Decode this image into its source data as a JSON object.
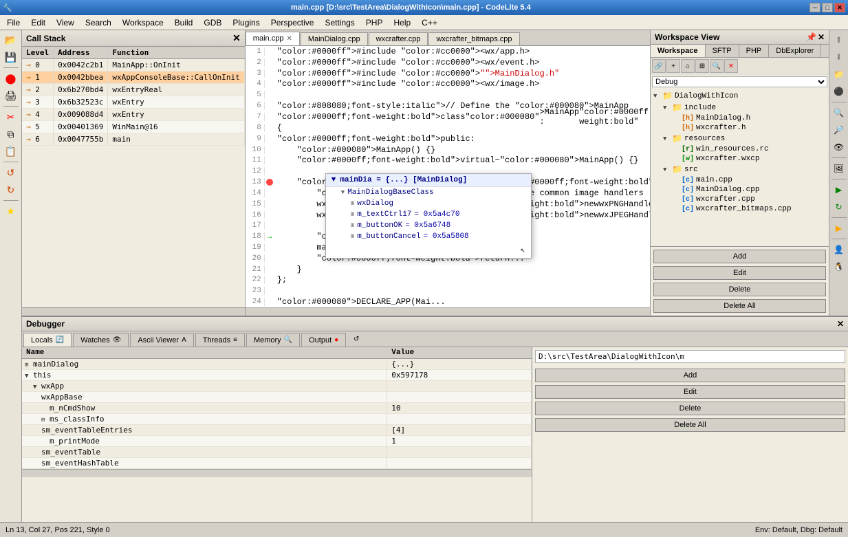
{
  "titlebar": {
    "title": "main.cpp [D:\\src\\TestArea\\DialogWithIcon\\main.cpp] - CodeLite 5.4",
    "min": "─",
    "max": "□",
    "close": "✕"
  },
  "menubar": {
    "items": [
      "File",
      "Edit",
      "View",
      "Search",
      "Workspace",
      "Build",
      "GDB",
      "Plugins",
      "Perspective",
      "Settings",
      "PHP",
      "Help",
      "C++"
    ]
  },
  "callstack": {
    "title": "Call Stack",
    "columns": [
      "Level",
      "Address",
      "Function"
    ],
    "rows": [
      {
        "level": "0",
        "addr": "0x0042c2b1",
        "func": "MainApp::OnInit",
        "active": false,
        "arrow": "→"
      },
      {
        "level": "1",
        "addr": "0x0042bbea",
        "func": "wxAppConsoleBase::CallOnInit",
        "active": true,
        "arrow": "→"
      },
      {
        "level": "2",
        "addr": "0x6b270bd4",
        "func": "wxEntryReal",
        "active": false,
        "arrow": "→"
      },
      {
        "level": "3",
        "addr": "0x6b32523c",
        "func": "wxEntry",
        "active": false,
        "arrow": "→"
      },
      {
        "level": "4",
        "addr": "0x009088d4",
        "func": "wxEntry",
        "active": false,
        "arrow": "→"
      },
      {
        "level": "5",
        "addr": "0x00401369",
        "func": "WinMain@16",
        "active": false,
        "arrow": "→"
      },
      {
        "level": "6",
        "addr": "0x0047755b",
        "func": "main",
        "active": false,
        "arrow": "→"
      }
    ]
  },
  "editor": {
    "tabs": [
      {
        "label": "main.cpp",
        "active": true,
        "modified": false
      },
      {
        "label": "MainDialog.cpp",
        "active": false
      },
      {
        "label": "wxcrafter.cpp",
        "active": false
      },
      {
        "label": "wxcrafter_bitmaps.cpp",
        "active": false
      }
    ],
    "statusline": "Ln 13,  Col 27,  Pos 221,  Style 0"
  },
  "autocomplete": {
    "header": "mainDia = {...} [MainDialog]",
    "items": [
      {
        "indent": 1,
        "expand": "▼",
        "name": "MainDialogBaseClass",
        "val": ""
      },
      {
        "indent": 2,
        "expand": "⊞",
        "name": "wxDialog",
        "val": ""
      },
      {
        "indent": 2,
        "expand": "⊞",
        "name": "m_textCtrl17",
        "val": "= 0x5a4c70"
      },
      {
        "indent": 2,
        "expand": "⊞",
        "name": "m_buttonOK",
        "val": "= 0x5a6748"
      },
      {
        "indent": 2,
        "expand": "⊞",
        "name": "m_buttonCancel",
        "val": "= 0x5a5808"
      }
    ]
  },
  "workspace": {
    "title": "Workspace View",
    "tabs": [
      "Workspace",
      "SFTP",
      "PHP",
      "DbExplorer"
    ],
    "active_tab": "Workspace",
    "debug_config": "Debug",
    "tree": {
      "root": "DialogWithIcon",
      "items": [
        {
          "indent": 0,
          "expand": "▼",
          "icon": "folder",
          "name": "DialogWithIcon"
        },
        {
          "indent": 1,
          "expand": "▼",
          "icon": "folder",
          "name": "include"
        },
        {
          "indent": 2,
          "expand": "",
          "icon": "h",
          "name": "MainDialog.h"
        },
        {
          "indent": 2,
          "expand": "",
          "icon": "h",
          "name": "wxcrafter.h"
        },
        {
          "indent": 1,
          "expand": "▼",
          "icon": "folder",
          "name": "resources"
        },
        {
          "indent": 2,
          "expand": "",
          "icon": "rc",
          "name": "win_resources.rc"
        },
        {
          "indent": 2,
          "expand": "",
          "icon": "wxcp",
          "name": "wxcrafter.wxcp"
        },
        {
          "indent": 1,
          "expand": "▼",
          "icon": "folder",
          "name": "src"
        },
        {
          "indent": 2,
          "expand": "",
          "icon": "cpp",
          "name": "main.cpp"
        },
        {
          "indent": 2,
          "expand": "",
          "icon": "cpp",
          "name": "MainDialog.cpp"
        },
        {
          "indent": 2,
          "expand": "",
          "icon": "cpp",
          "name": "wxcrafter.cpp"
        },
        {
          "indent": 2,
          "expand": "",
          "icon": "cpp",
          "name": "wxcrafter_bitmaps.cpp"
        }
      ]
    },
    "buttons": [
      "Add",
      "Edit",
      "Delete",
      "Delete All"
    ]
  },
  "debugger": {
    "title": "Debugger",
    "tabs": [
      "Locals",
      "Watches",
      "Ascii Viewer",
      "Threads",
      "Memory",
      "Output"
    ],
    "columns": [
      "Name",
      "Value"
    ],
    "locals": [
      {
        "indent": 0,
        "expand": "⊞",
        "name": "mainDialog",
        "val": "{...}"
      },
      {
        "indent": 0,
        "expand": "▼",
        "name": "this",
        "val": "0x597178"
      },
      {
        "indent": 1,
        "expand": "▼",
        "name": "wxApp",
        "val": ""
      },
      {
        "indent": 2,
        "expand": "",
        "name": "wxAppBase",
        "val": ""
      },
      {
        "indent": 3,
        "expand": "",
        "name": "m_nCmdShow",
        "val": "10"
      },
      {
        "indent": 2,
        "expand": "⊞",
        "name": "ms_classInfo",
        "val": ""
      },
      {
        "indent": 2,
        "expand": "",
        "name": "sm_eventTableEntries",
        "val": "[4]"
      },
      {
        "indent": 3,
        "expand": "",
        "name": "m_printMode",
        "val": "1"
      },
      {
        "indent": 2,
        "expand": "",
        "name": "sm_eventTable",
        "val": ""
      },
      {
        "indent": 2,
        "expand": "",
        "name": "sm_eventHashTable",
        "val": ""
      }
    ],
    "path": "D:\\src\\TestArea\\DialogWithIcon\\m",
    "action_buttons": [
      "Add",
      "Edit",
      "Delete",
      "Delete All"
    ]
  },
  "statusbar": {
    "text": "Env: Default, Dbg: Default"
  },
  "code": {
    "lines": [
      {
        "num": 1,
        "gutter": "",
        "text": "#include <wx/app.h>"
      },
      {
        "num": 2,
        "gutter": "",
        "text": "#include <wx/event.h>"
      },
      {
        "num": 3,
        "gutter": "",
        "text": "#include \"MainDialog.h\""
      },
      {
        "num": 4,
        "gutter": "",
        "text": "#include <wx/image.h>"
      },
      {
        "num": 5,
        "gutter": "",
        "text": ""
      },
      {
        "num": 6,
        "gutter": "",
        "text": "// Define the MainApp"
      },
      {
        "num": 7,
        "gutter": "",
        "text": "class MainApp : public wxApp"
      },
      {
        "num": 8,
        "gutter": "",
        "text": "{"
      },
      {
        "num": 9,
        "gutter": "",
        "text": "public:"
      },
      {
        "num": 10,
        "gutter": "",
        "text": "    MainApp() {}"
      },
      {
        "num": 11,
        "gutter": "",
        "text": "    virtual ~MainApp() {}"
      },
      {
        "num": 12,
        "gutter": "",
        "text": ""
      },
      {
        "num": 13,
        "gutter": "bp",
        "text": "    virtual bool OnInit() {"
      },
      {
        "num": 14,
        "gutter": "",
        "text": "        // Add the common image handlers"
      },
      {
        "num": 15,
        "gutter": "",
        "text": "        wxImage::AddHandler( new wxPNGHandler );"
      },
      {
        "num": 16,
        "gutter": "",
        "text": "        wxImage::AddHandler( new wxJPEGHandler );"
      },
      {
        "num": 17,
        "gutter": "",
        "text": ""
      },
      {
        "num": 18,
        "gutter": "arrow",
        "text": "        MainDialog mainDialog(NULL);"
      },
      {
        "num": 19,
        "gutter": "",
        "text": "        mainDia..."
      },
      {
        "num": 20,
        "gutter": "",
        "text": "        return ..."
      },
      {
        "num": 21,
        "gutter": "",
        "text": "    }"
      },
      {
        "num": 22,
        "gutter": "",
        "text": "};"
      },
      {
        "num": 23,
        "gutter": "",
        "text": ""
      },
      {
        "num": 24,
        "gutter": "",
        "text": "DECLARE_APP(Mai..."
      }
    ]
  }
}
